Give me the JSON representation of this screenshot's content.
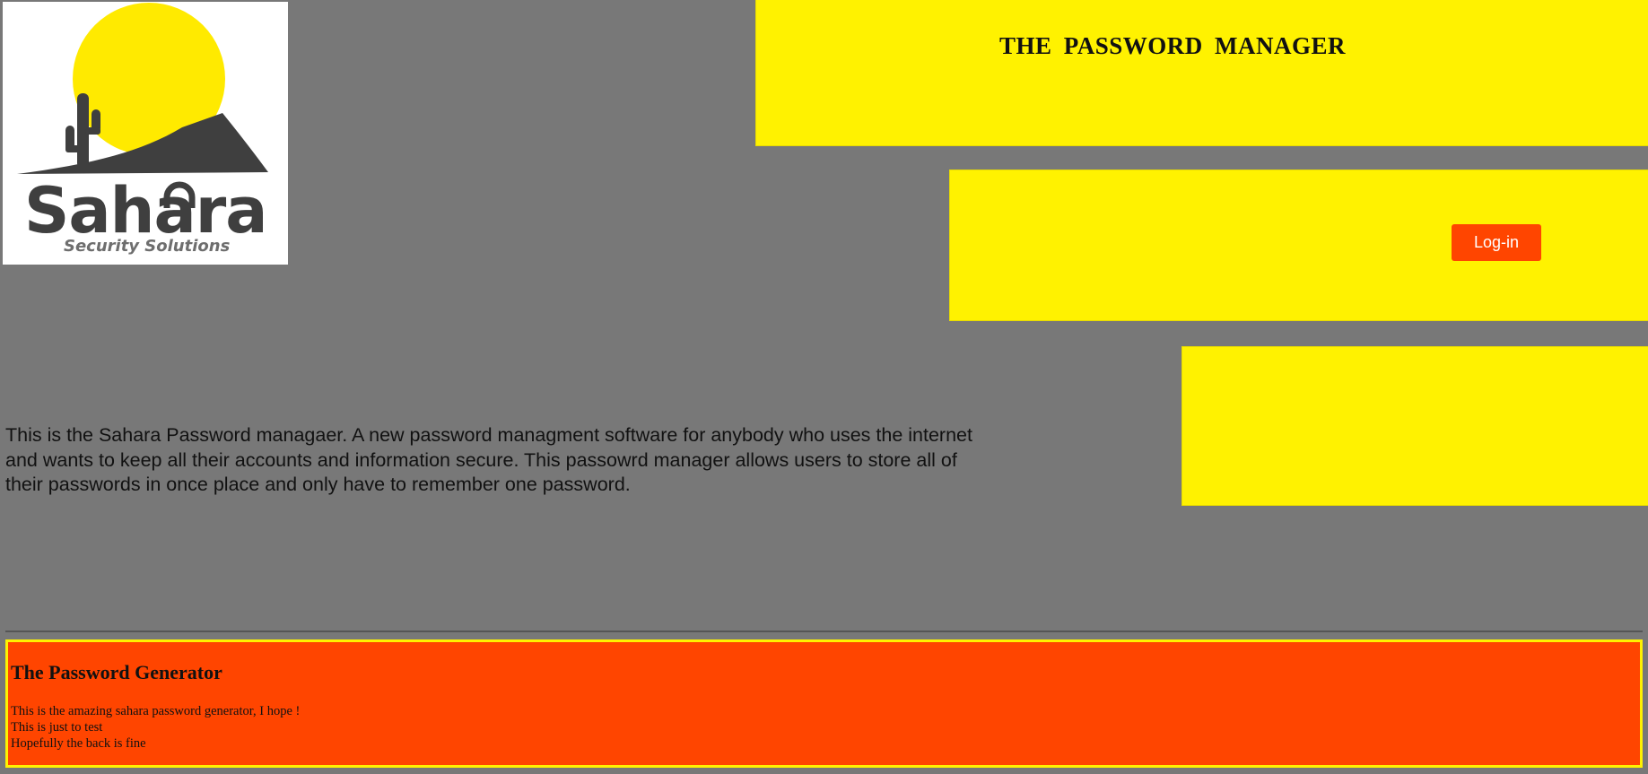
{
  "logo": {
    "brand_name": "Sahara",
    "tagline": "Security Solutions"
  },
  "header": {
    "title": "THE PASSWORD MANAGER"
  },
  "login": {
    "button_label": "Log-in"
  },
  "intro": {
    "text": "This is the Sahara Password managaer. A new password managment software for anybody who uses the internet and wants to keep all their accounts and information secure. This passowrd manager allows users to store all of their passwords in once place and only have to remember one password."
  },
  "generator": {
    "title": "The Password Generator",
    "lines": [
      "This is the amazing sahara password generator, I hope !",
      "This is just to test",
      "Hopefully the back is fine"
    ]
  },
  "colors": {
    "background": "#787878",
    "panel_yellow": "#fff200",
    "accent_orange": "#ff4500",
    "logo_yellow": "#ffea00",
    "logo_dark": "#3f3f3f"
  },
  "icons": {
    "logo_sun": "sun-icon",
    "logo_cactus": "cactus-icon",
    "logo_lock": "padlock-icon"
  }
}
